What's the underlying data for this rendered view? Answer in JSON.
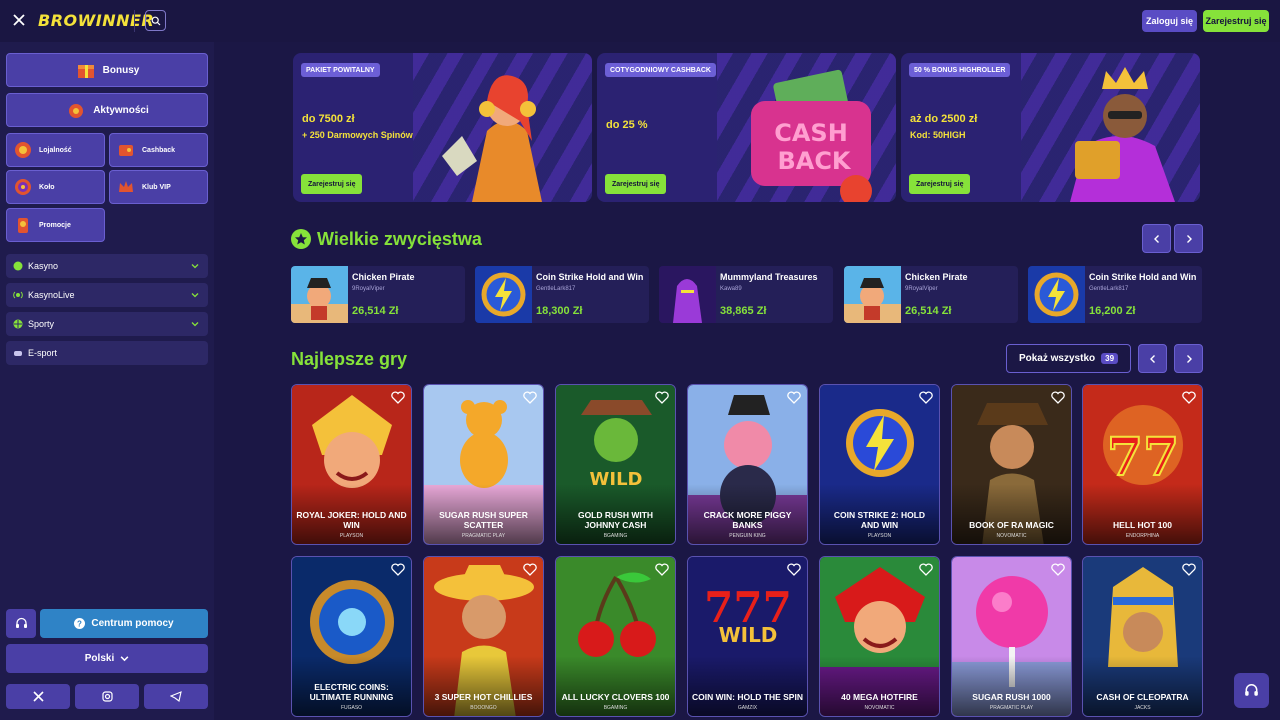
{
  "header": {
    "logo": "BROWINNER",
    "login": "Zaloguj się",
    "register": "Zarejestruj się"
  },
  "sidebar": {
    "big": [
      {
        "label": "Bonusy",
        "icon": "bonus-gift-icon"
      },
      {
        "label": "Aktywności",
        "icon": "activity-icon"
      }
    ],
    "small": [
      {
        "label": "Lojalność",
        "icon": "loyalty-icon"
      },
      {
        "label": "Cashback",
        "icon": "cashback-icon"
      },
      {
        "label": "Koło",
        "icon": "wheel-icon"
      },
      {
        "label": "Klub VIP",
        "icon": "vip-crown-icon"
      },
      {
        "label": "Promocje",
        "icon": "promo-icon"
      }
    ],
    "nav": [
      {
        "label": "Kasyno"
      },
      {
        "label": "KasynoLive"
      },
      {
        "label": "Sporty"
      },
      {
        "label": "E-sport"
      }
    ],
    "help": "Centrum pomocy",
    "language": "Polski"
  },
  "banners": [
    {
      "tag": "PAKIET POWITALNY",
      "line1": "do 7500 zł",
      "line2": "+ 250 Darmowych Spinów",
      "cta": "Zarejestruj się"
    },
    {
      "tag": "COTYGODNIOWY CASHBACK",
      "line1": "do 25 %",
      "line2": "",
      "cta": "Zarejestruj się"
    },
    {
      "tag": "50 % BONUS HIGHROLLER",
      "line1": "aż do 2500 zł",
      "line2": "Kod: 50HIGH",
      "cta": "Zarejestruj się"
    }
  ],
  "wins": {
    "title": "Wielkie zwycięstwa",
    "items": [
      {
        "game": "Chicken Pirate",
        "user": "9RoyalViper",
        "amount": "26,514 Zł"
      },
      {
        "game": "Coin Strike Hold and Win",
        "user": "GentleLark817",
        "amount": "18,300 Zł"
      },
      {
        "game": "Mummyland Treasures",
        "user": "Kawa89",
        "amount": "38,865 Zł"
      },
      {
        "game": "Chicken Pirate",
        "user": "9RoyalViper",
        "amount": "26,514 Zł"
      },
      {
        "game": "Coin Strike Hold and Win",
        "user": "GentleLark817",
        "amount": "16,200 Zł"
      }
    ]
  },
  "games": {
    "title": "Najlepsze gry",
    "show_all": "Pokaż wszystko",
    "count": "39",
    "items": [
      {
        "name": "Royal Joker: Hold and Win",
        "provider": "PLAYSON"
      },
      {
        "name": "Sugar Rush Super Scatter",
        "provider": "PRAGMATIC PLAY"
      },
      {
        "name": "Gold Rush with Johnny Cash",
        "provider": "BGAMING"
      },
      {
        "name": "Crack More Piggy Banks",
        "provider": "PENGUIN KING"
      },
      {
        "name": "Coin Strike 2: Hold and Win",
        "provider": "PLAYSON"
      },
      {
        "name": "Book of Ra Magic",
        "provider": "NOVOMATIC"
      },
      {
        "name": "Hell Hot 100",
        "provider": "ENDORPHINA"
      },
      {
        "name": "Electric Coins: Ultimate Running",
        "provider": "FUGASO"
      },
      {
        "name": "3 Super Hot Chillies",
        "provider": "BOOONGO"
      },
      {
        "name": "All Lucky Clovers 100",
        "provider": "BGAMING"
      },
      {
        "name": "Coin Win: Hold The Spin",
        "provider": "GAMZIX"
      },
      {
        "name": "40 Mega Hotfire",
        "provider": "NOVOMATIC"
      },
      {
        "name": "Sugar Rush 1000",
        "provider": "PRAGMATIC PLAY"
      },
      {
        "name": "Cash of Cleopatra",
        "provider": "JACKS"
      }
    ]
  },
  "colors": {
    "accent": "#86e23a",
    "primary": "#4a3fa6",
    "bg": "#1b1745",
    "logo": "#f4e23a"
  }
}
